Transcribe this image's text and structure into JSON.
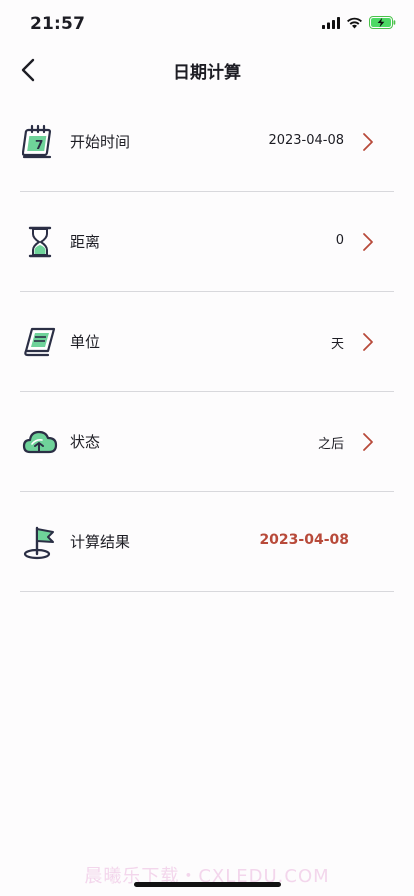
{
  "status_bar": {
    "time": "21:57",
    "icons": [
      "cellular-signal-icon",
      "wifi-icon",
      "battery-charging-icon"
    ]
  },
  "nav": {
    "title": "日期计算",
    "back_icon": "chevron-left-icon"
  },
  "rows": [
    {
      "label": "开始时间",
      "value": "2023-04-08",
      "icon": "calendar-icon",
      "has_chevron": true
    },
    {
      "label": "距离",
      "value": "0",
      "icon": "hourglass-icon",
      "has_chevron": true
    },
    {
      "label": "单位",
      "value": "天",
      "icon": "notebook-icon",
      "has_chevron": true
    },
    {
      "label": "状态",
      "value": "之后",
      "icon": "cloud-icon",
      "has_chevron": true
    },
    {
      "label": "计算结果",
      "value": "2023-04-08",
      "icon": "flag-icon",
      "has_chevron": false
    }
  ],
  "colors": {
    "accent": "#b84a3a",
    "icon_green": "#6fd39a",
    "icon_dark": "#2b2f45",
    "divider": "#d8d8dc",
    "watermark": "#f3d6ec"
  },
  "watermark": "晨曦乐下载・CXLEDU.COM"
}
